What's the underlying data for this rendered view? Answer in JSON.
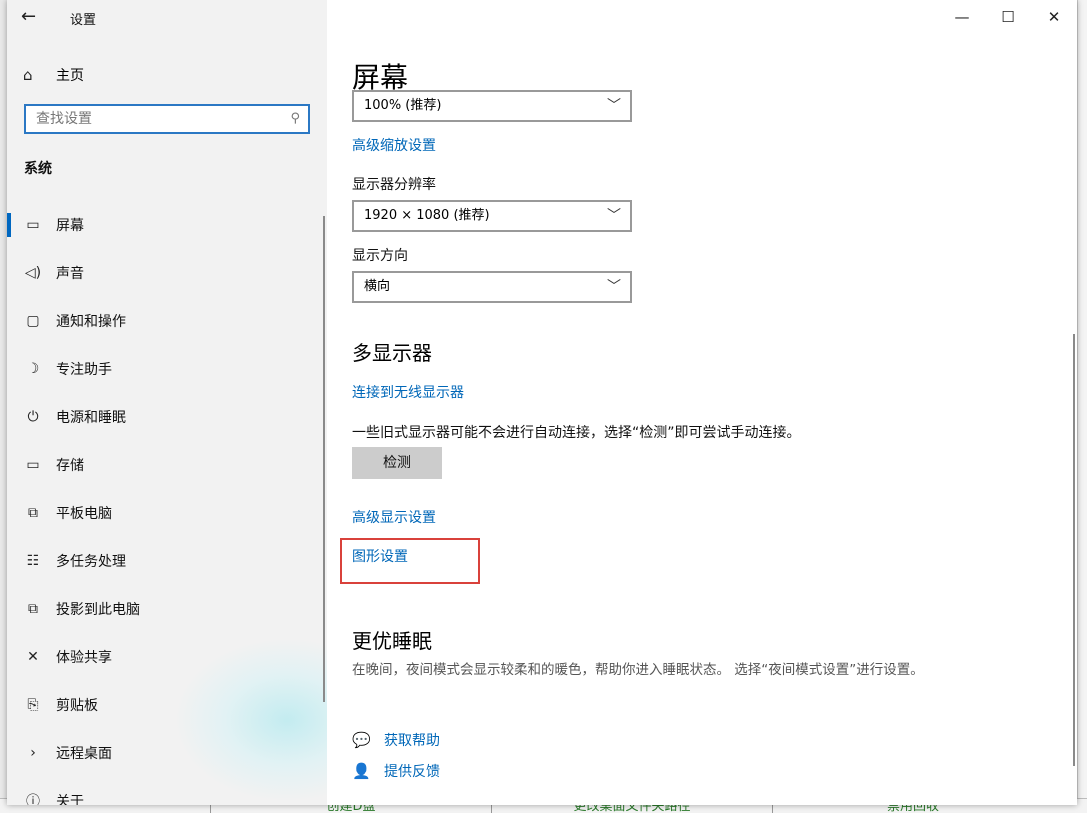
{
  "window": {
    "title": "设置"
  },
  "sidebar": {
    "home_label": "主页",
    "search_placeholder": "查找设置",
    "section_label": "系统",
    "items": [
      {
        "icon": "monitor-icon",
        "glyph": "▭",
        "label": "屏幕",
        "active": true
      },
      {
        "icon": "speaker-icon",
        "glyph": "🔈",
        "label": "声音"
      },
      {
        "icon": "notification-icon",
        "glyph": "▢",
        "label": "通知和操作"
      },
      {
        "icon": "moon-icon",
        "glyph": "☽",
        "label": "专注助手"
      },
      {
        "icon": "power-icon",
        "glyph": "⏻",
        "label": "电源和睡眠"
      },
      {
        "icon": "storage-icon",
        "glyph": "▭",
        "label": "存储"
      },
      {
        "icon": "tablet-icon",
        "glyph": "⧉",
        "label": "平板电脑"
      },
      {
        "icon": "multitask-icon",
        "glyph": "☷",
        "label": "多任务处理"
      },
      {
        "icon": "project-icon",
        "glyph": "⧉",
        "label": "投影到此电脑"
      },
      {
        "icon": "share-icon",
        "glyph": "✕",
        "label": "体验共享"
      },
      {
        "icon": "clipboard-icon",
        "glyph": "📋",
        "label": "剪贴板"
      },
      {
        "icon": "remote-icon",
        "glyph": "›",
        "label": "远程桌面"
      },
      {
        "icon": "info-icon",
        "glyph": "ⓘ",
        "label": "关于"
      }
    ]
  },
  "main": {
    "page_title": "屏幕",
    "scale_value": "100% (推荐)",
    "advanced_scaling_link": "高级缩放设置",
    "resolution_label": "显示器分辨率",
    "resolution_value": "1920 × 1080 (推荐)",
    "orientation_label": "显示方向",
    "orientation_value": "横向",
    "multi_display_heading": "多显示器",
    "wireless_link": "连接到无线显示器",
    "detect_description": "一些旧式显示器可能不会进行自动连接，选择“检测”即可尝试手动连接。",
    "detect_button": "检测",
    "advanced_display_link": "高级显示设置",
    "graphics_link": "图形设置",
    "sleep_heading": "更优睡眠",
    "sleep_description": "在晚间，夜间模式会显示较柔和的暖色，帮助你进入睡眠状态。 选择“夜间模式设置”进行设置。",
    "get_help": "获取帮助",
    "give_feedback": "提供反馈"
  },
  "background_app": {
    "bottom_cells": [
      "创建D盘",
      "更改桌面文件夹路径",
      "禁用回收"
    ]
  },
  "colors": {
    "accent": "#0067b8",
    "highlight_box": "#d9413b",
    "sidebar_bg": "#f2f2f2"
  }
}
